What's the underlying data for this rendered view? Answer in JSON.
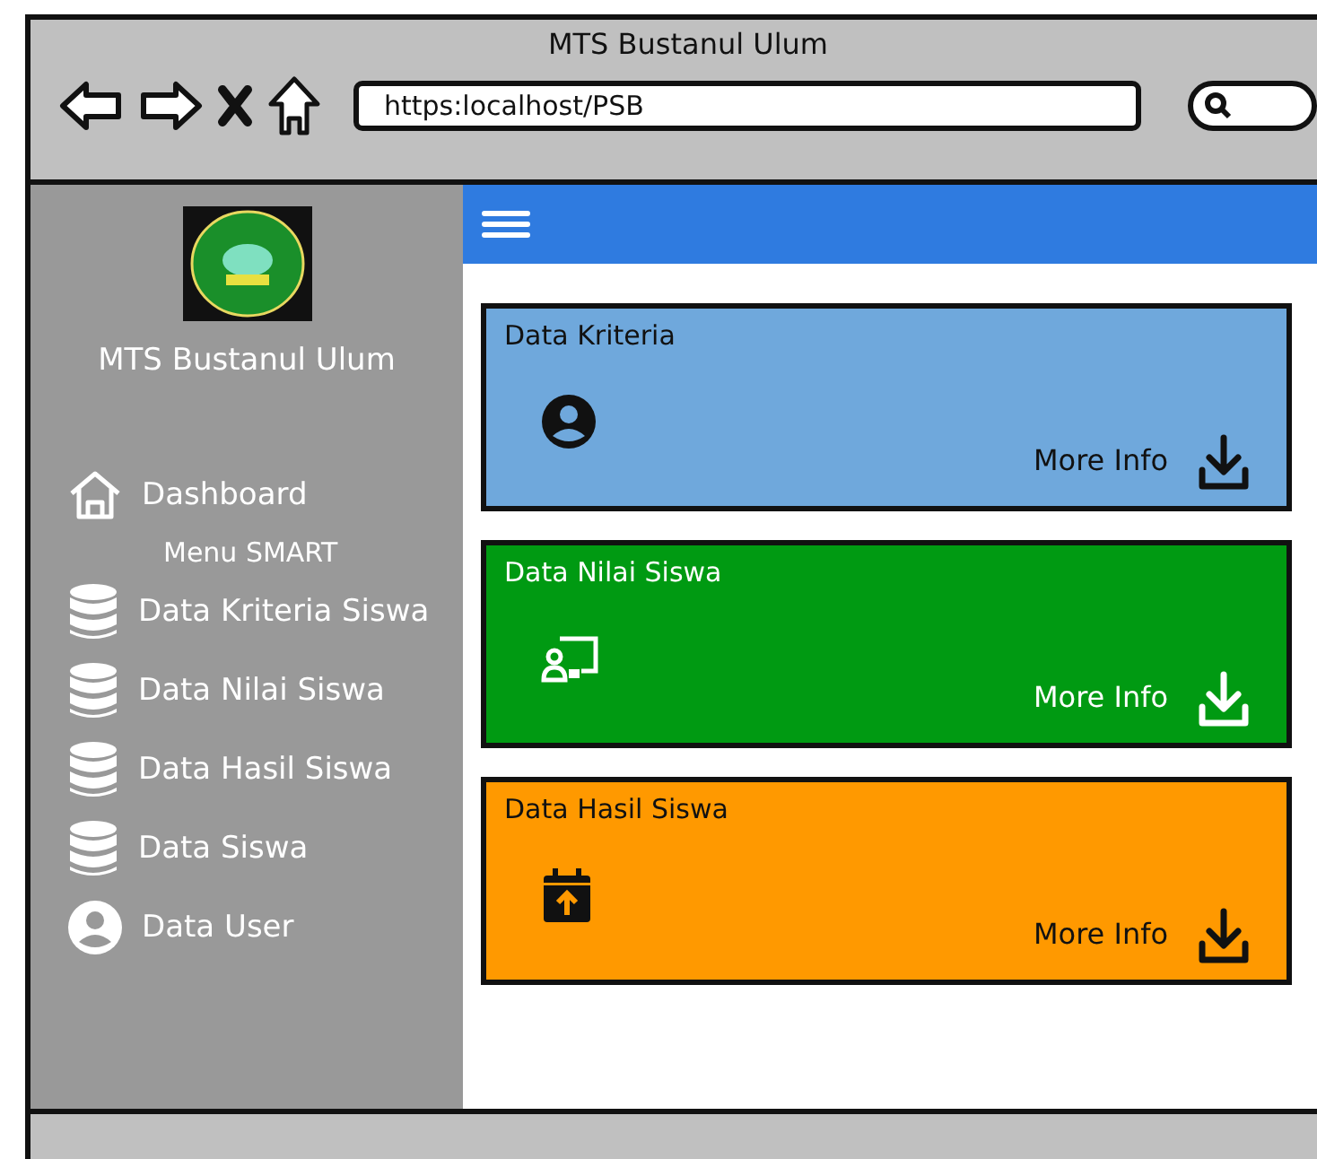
{
  "window": {
    "title": "MTS Bustanul Ulum"
  },
  "address_bar": {
    "value": "https:localhost/PSB"
  },
  "sidebar": {
    "title": "MTS Bustanul Ulum",
    "items": [
      {
        "kind": "home",
        "label": "Dashboard"
      },
      {
        "kind": "heading",
        "label": "Menu SMART"
      },
      {
        "kind": "database",
        "label": "Data Kriteria Siswa"
      },
      {
        "kind": "database",
        "label": "Data Nilai Siswa"
      },
      {
        "kind": "database",
        "label": "Data Hasil Siswa"
      },
      {
        "kind": "database",
        "label": "Data Siswa"
      },
      {
        "kind": "user",
        "label": "Data User"
      }
    ]
  },
  "cards": [
    {
      "title": "Data Kriteria",
      "kind": "user",
      "color": "#6fa8dc",
      "link": "More Info"
    },
    {
      "title": "Data Nilai Siswa",
      "kind": "presentation",
      "color": "#009a12",
      "link": "More Info"
    },
    {
      "title": "Data Hasil Siswa",
      "kind": "calendar",
      "color": "#ff9900",
      "link": "More Info"
    }
  ]
}
